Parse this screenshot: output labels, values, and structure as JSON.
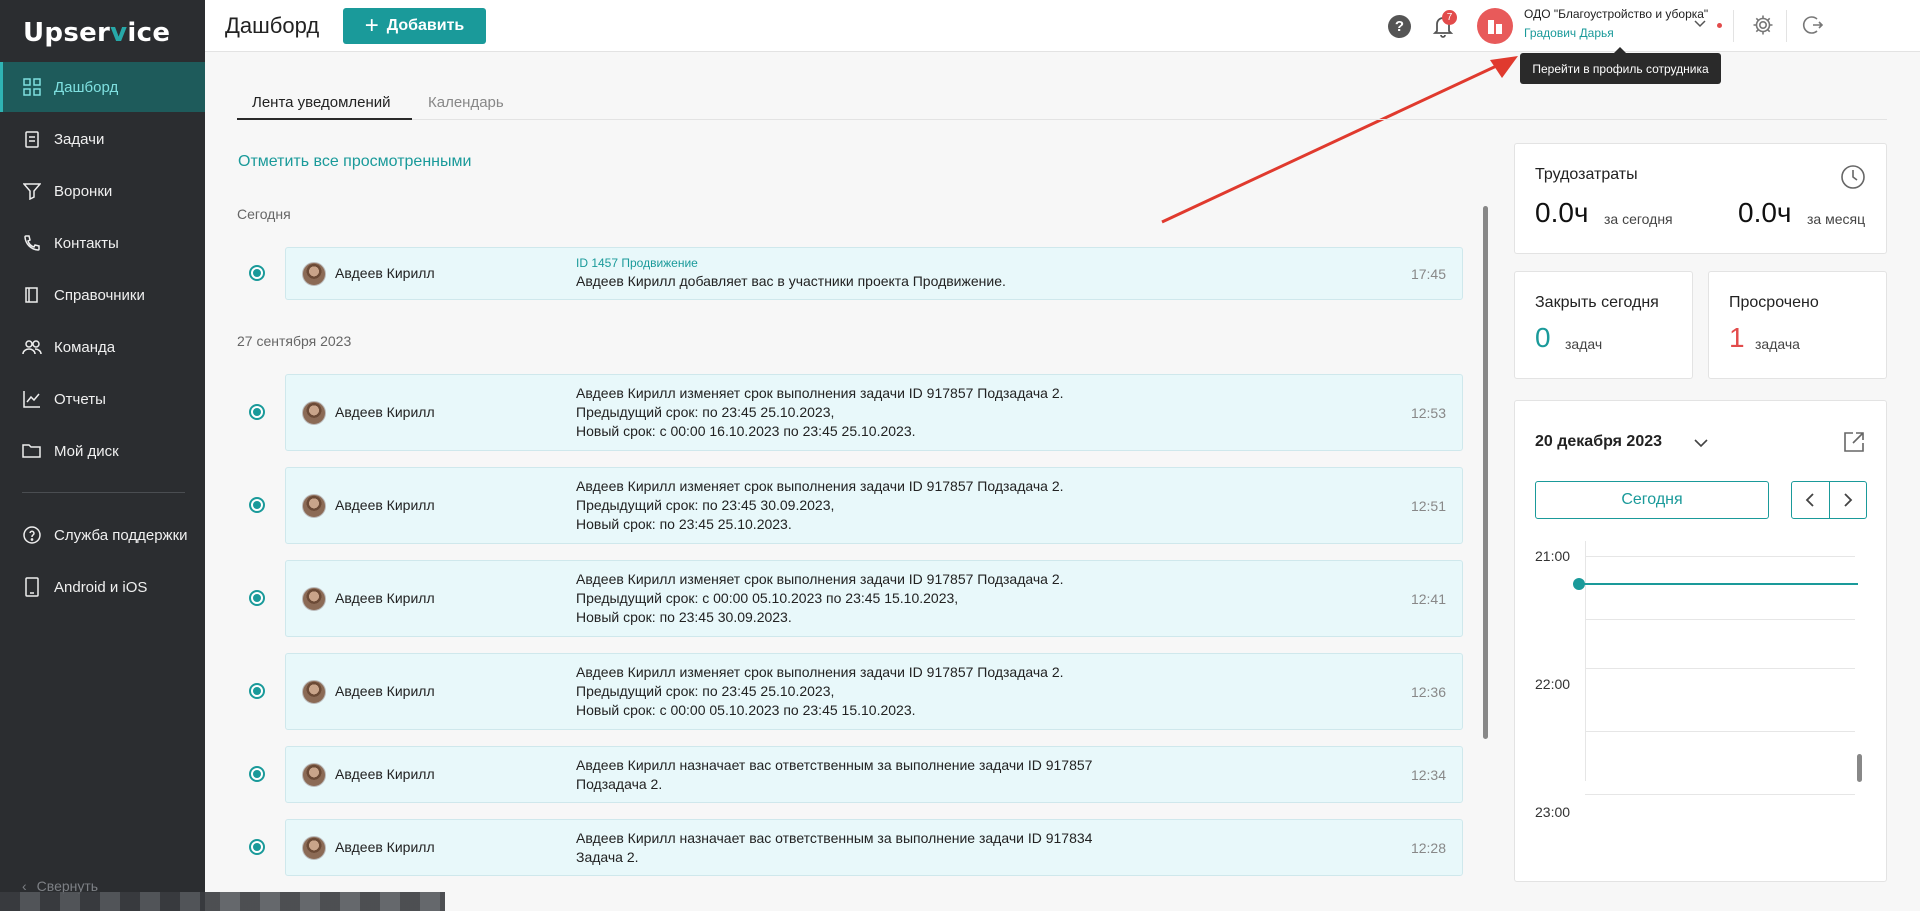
{
  "app": {
    "logo_part1": "Upser",
    "logo_v": "v",
    "logo_part2": "ice"
  },
  "sidebar": {
    "items": [
      {
        "label": "Дашборд",
        "icon": "dashboard-icon",
        "active": true
      },
      {
        "label": "Задачи",
        "icon": "tasks-icon"
      },
      {
        "label": "Воронки",
        "icon": "funnel-icon"
      },
      {
        "label": "Контакты",
        "icon": "contacts-icon"
      },
      {
        "label": "Справочники",
        "icon": "book-icon"
      },
      {
        "label": "Команда",
        "icon": "team-icon"
      },
      {
        "label": "Отчеты",
        "icon": "reports-icon"
      },
      {
        "label": "Мой диск",
        "icon": "folder-icon"
      },
      {
        "label": "Служба поддержки",
        "icon": "support-icon"
      },
      {
        "label": "Android и iOS",
        "icon": "mobile-icon"
      }
    ],
    "collapse_label": "Свернуть"
  },
  "header": {
    "title": "Дашборд",
    "add_label": "Добавить",
    "notif_count": "7",
    "org_name": "ОДО \"Благоустройство и уборка\"",
    "user_name": "Градович Дарья",
    "tooltip": "Перейти в профиль сотрудника"
  },
  "tabs": [
    {
      "label": "Лента уведомлений",
      "active": true
    },
    {
      "label": "Календарь",
      "active": false
    }
  ],
  "feed": {
    "mark_all": "Отметить все просмотренными",
    "groups": [
      {
        "label": "Сегодня",
        "items": [
          {
            "author": "Авдеев Кирилл",
            "id_line": "ID 1457 Продвижение",
            "lines": [
              "Авдеев Кирилл добавляет вас в участники проекта Продвижение."
            ],
            "time": "17:45"
          }
        ]
      },
      {
        "label": "27 сентября 2023",
        "items": [
          {
            "author": "Авдеев Кирилл",
            "lines": [
              "Авдеев Кирилл изменяет срок выполнения задачи ID 917857 Подзадача 2.",
              "Предыдущий срок: по 23:45 25.10.2023,",
              "Новый срок: с 00:00 16.10.2023 по 23:45 25.10.2023."
            ],
            "time": "12:53"
          },
          {
            "author": "Авдеев Кирилл",
            "lines": [
              "Авдеев Кирилл изменяет срок выполнения задачи ID 917857 Подзадача 2.",
              "Предыдущий срок: по 23:45 30.09.2023,",
              "Новый срок: по 23:45 25.10.2023."
            ],
            "time": "12:51"
          },
          {
            "author": "Авдеев Кирилл",
            "lines": [
              "Авдеев Кирилл изменяет срок выполнения задачи ID 917857 Подзадача 2.",
              "Предыдущий срок: с 00:00 05.10.2023 по 23:45 15.10.2023,",
              "Новый срок: по 23:45 30.09.2023."
            ],
            "time": "12:41"
          },
          {
            "author": "Авдеев Кирилл",
            "lines": [
              "Авдеев Кирилл изменяет срок выполнения задачи ID 917857 Подзадача 2.",
              "Предыдущий срок: по 23:45 25.10.2023,",
              "Новый срок: с 00:00 05.10.2023 по 23:45 15.10.2023."
            ],
            "time": "12:36"
          },
          {
            "author": "Авдеев Кирилл",
            "lines": [
              "Авдеев Кирилл назначает вас ответственным за выполнение задачи ID 917857",
              "Подзадача 2."
            ],
            "time": "12:34"
          },
          {
            "author": "Авдеев Кирилл",
            "lines": [
              "Авдеев Кирилл назначает вас ответственным за выполнение задачи ID 917834",
              "Задача 2."
            ],
            "time": "12:28"
          }
        ]
      }
    ]
  },
  "labor": {
    "title": "Трудозатраты",
    "today_value": "0.0ч",
    "today_caption": "за сегодня",
    "month_value": "0.0ч",
    "month_caption": "за месяц"
  },
  "close_today": {
    "title": "Закрыть сегодня",
    "value": "0",
    "caption": "задач",
    "color": "#1a9a9a"
  },
  "overdue": {
    "title": "Просрочено",
    "value": "1",
    "caption": "задача",
    "color": "#e24b4b"
  },
  "calendar": {
    "date": "20 декабря 2023",
    "today_label": "Сегодня",
    "hours": [
      "21:00",
      "22:00",
      "23:00"
    ]
  },
  "colors": {
    "accent": "#1a9a9a",
    "sidebar_bg": "#2b2d30",
    "danger": "#e24b4b"
  }
}
